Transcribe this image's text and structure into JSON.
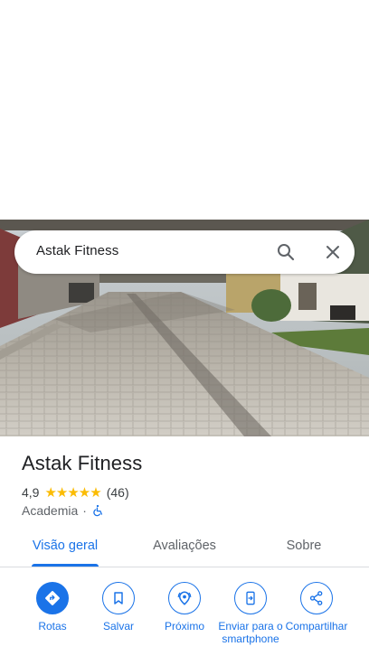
{
  "search": {
    "query": "Astak Fitness",
    "search_icon": "search-icon",
    "close_icon": "close-icon"
  },
  "place": {
    "name": "Astak Fitness",
    "rating": "4,9",
    "stars": "★★★★★",
    "review_count": "(46)",
    "category": "Academia",
    "separator": "·",
    "accessibility_icon": "wheelchair-icon"
  },
  "tabs": [
    {
      "label": "Visão geral",
      "active": true
    },
    {
      "label": "Avaliações",
      "active": false
    },
    {
      "label": "Sobre",
      "active": false
    }
  ],
  "actions": [
    {
      "label": "Rotas",
      "icon": "directions-icon"
    },
    {
      "label": "Salvar",
      "icon": "bookmark-icon"
    },
    {
      "label": "Próximo",
      "icon": "nearby-icon"
    },
    {
      "label": "Enviar para o smartphone",
      "icon": "send-to-phone-icon"
    },
    {
      "label": "Compartilhar",
      "icon": "share-icon"
    }
  ],
  "colors": {
    "accent": "#1a73e8",
    "star": "#fbbc04",
    "text_primary": "#202124",
    "text_secondary": "#5f6368"
  }
}
